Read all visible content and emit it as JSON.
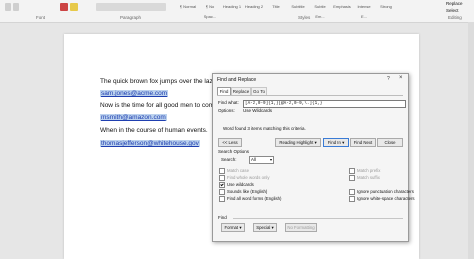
{
  "ribbon": {
    "groups": [
      "Font",
      "Paragraph",
      "Styles",
      "Editing"
    ],
    "styles": [
      "¶ Normal",
      "¶ No Spac...",
      "Heading 1",
      "Heading 2",
      "Title",
      "Subtitle",
      "Subtle Em...",
      "Emphasis",
      "Intense E...",
      "Strong"
    ],
    "replace_label": "Replace",
    "select_label": "Select"
  },
  "document": {
    "lines": [
      {
        "text": "The quick brown fox jumps over the lazy lo",
        "link": false
      },
      {
        "text": "sam.jones@acme.com",
        "link": true
      },
      {
        "text": "Now is the time for all good men to come t",
        "link": false
      },
      {
        "text": "msmith@amazon.com",
        "link": true
      },
      {
        "text": "When in the course of human events.",
        "link": false
      },
      {
        "text": "thomasjefferson@whitehouse.gov",
        "link": true
      }
    ]
  },
  "dialog": {
    "title": "Find and Replace",
    "help": "?",
    "close": "×",
    "tabs": [
      "Find",
      "Replace",
      "Go To"
    ],
    "find_what_label": "Find what:",
    "find_what_value": "[A-z,0-9]{1,}[@A-z,0-9,\\.]{1,}",
    "options_label": "Options:",
    "options_value": "Use Wildcards",
    "status": "Word found 3 items matching this criteria.",
    "buttons": {
      "less": "<< Less",
      "reading_highlight": "Reading Highlight ▾",
      "find_in": "Find In ▾",
      "find_next": "Find Next",
      "close": "Close",
      "format": "Format ▾",
      "special": "Special ▾",
      "no_formatting": "No Formatting"
    },
    "search_options_label": "Search Options",
    "search_label": "Search:",
    "search_value": "All",
    "checks_left": [
      {
        "label": "Match case",
        "checked": false,
        "disabled": true
      },
      {
        "label": "Find whole words only",
        "checked": false,
        "disabled": true
      },
      {
        "label": "Use wildcards",
        "checked": true,
        "disabled": false
      },
      {
        "label": "Sounds like (English)",
        "checked": false,
        "disabled": false
      },
      {
        "label": "Find all word forms (English)",
        "checked": false,
        "disabled": false
      }
    ],
    "checks_right": [
      {
        "label": "Match prefix",
        "checked": false,
        "disabled": true
      },
      {
        "label": "Match suffix",
        "checked": false,
        "disabled": true
      },
      {
        "label": "Ignore punctuation characters",
        "checked": false,
        "disabled": false
      },
      {
        "label": "Ignore white-space characters",
        "checked": false,
        "disabled": false
      }
    ],
    "find_section_label": "Find"
  }
}
